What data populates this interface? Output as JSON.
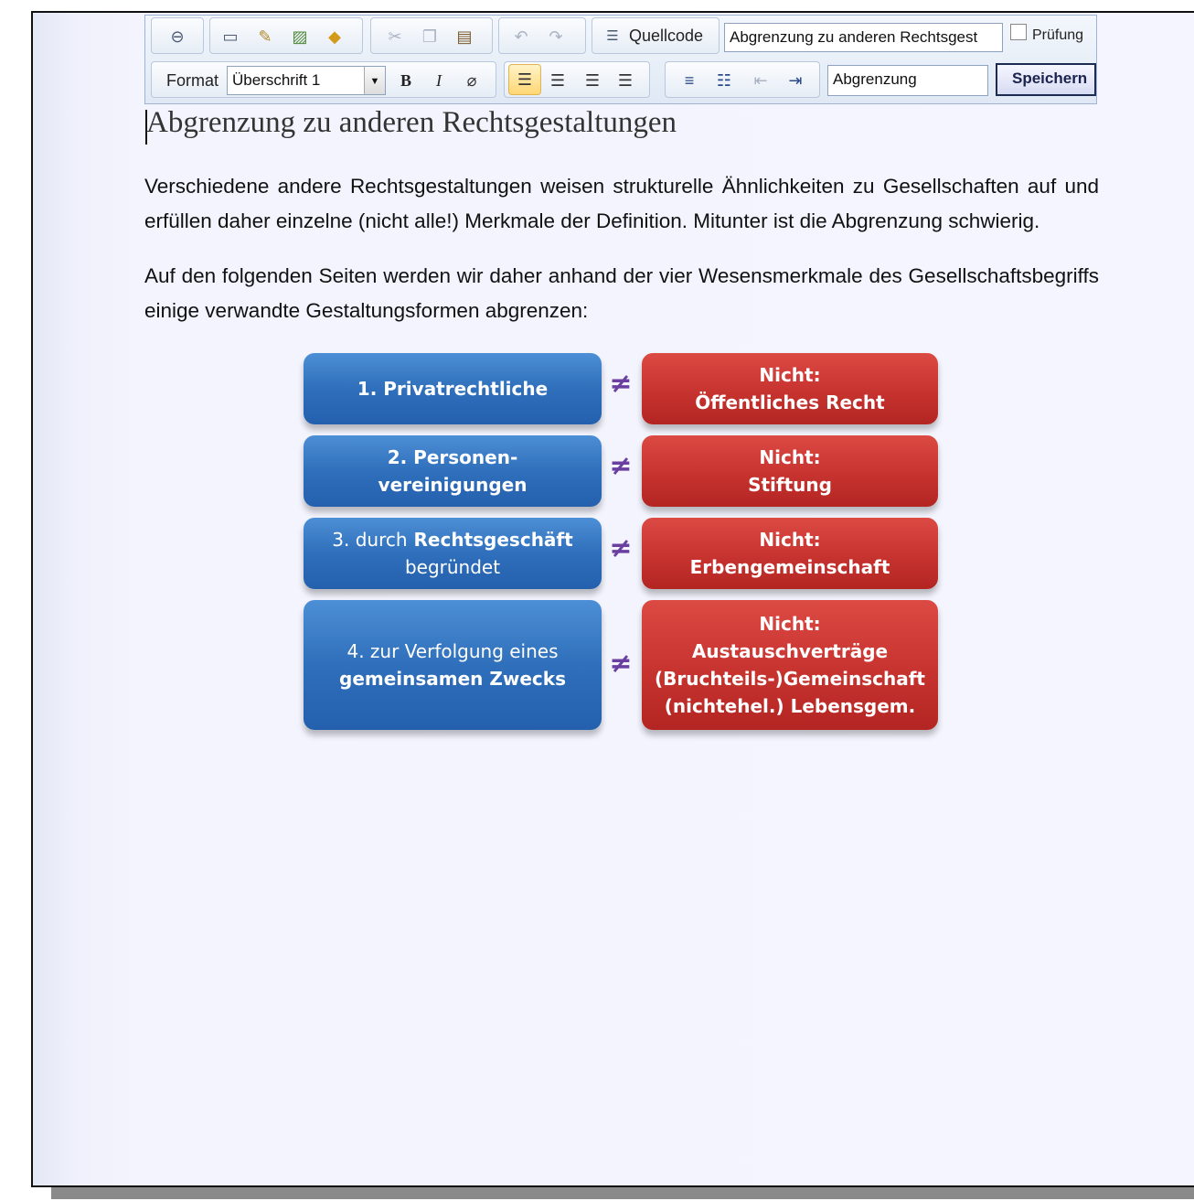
{
  "toolbar": {
    "source_label": "Quellcode",
    "title_input_value": "Abgrenzung zu anderen Rechtsgest",
    "pruefung_label": "Prüfung",
    "format_label": "Format",
    "format_selected": "Überschrift 1",
    "bold_label": "B",
    "italic_label": "I",
    "anchor_input_value": "Abgrenzung",
    "save_label": "Speichern"
  },
  "content": {
    "heading": "Abgrenzung zu anderen Rechtsgestaltungen",
    "paragraph1": "Verschiedene andere Rechtsgestaltungen weisen strukturelle Ähnlichkeiten zu Gesellschaften auf und erfüllen daher einzelne (nicht alle!) Merkmale der Definition. Mitunter ist die Abgrenzung schwierig.",
    "paragraph2": "Auf den folgenden Seiten werden wir daher anhand der vier Wesensmerkmale des Gesellschaftsbegriffs einige verwandte Gestaltungsformen abgrenzen:"
  },
  "diagram": {
    "neq_symbol": "≠",
    "rows": [
      {
        "left": [
          "1. Privatrechtliche"
        ],
        "right": [
          "Nicht:",
          "Öffentliches Recht"
        ]
      },
      {
        "left": [
          "2. Personen-",
          "vereinigungen"
        ],
        "right": [
          "Nicht:",
          "Stiftung"
        ]
      },
      {
        "left_a": "3. durch",
        "left_b": "Rechtsgeschäft",
        "left_c": "begründet",
        "right": [
          "Nicht:",
          "Erbengemeinschaft"
        ]
      },
      {
        "left": [
          "4. zur Verfolgung eines",
          "gemeinsamen Zwecks"
        ],
        "right": [
          "Nicht:",
          "Austauschverträge",
          "(Bruchteils-)Gemeinschaft",
          "(nichtehel.) Lebensgem."
        ]
      }
    ]
  },
  "colors": {
    "blue_box": "#2f6fbb",
    "red_box": "#c93531",
    "neq": "#6a3fa0"
  }
}
